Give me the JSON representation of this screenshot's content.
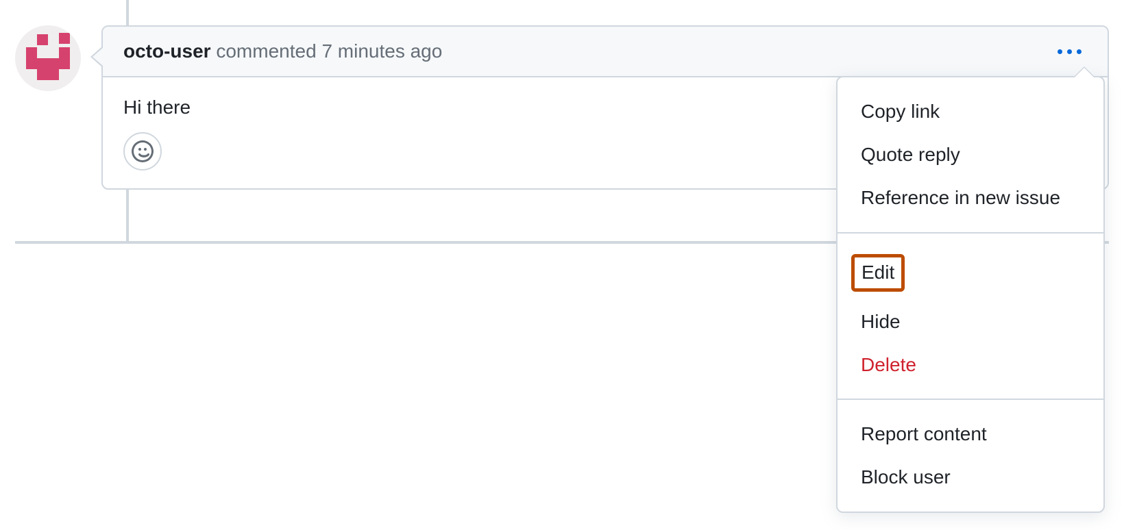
{
  "comment": {
    "author": "octo-user",
    "action": "commented",
    "timestamp": "7 minutes ago",
    "body": "Hi there"
  },
  "menu": {
    "section1": [
      {
        "label": "Copy link"
      },
      {
        "label": "Quote reply"
      },
      {
        "label": "Reference in new issue"
      }
    ],
    "section2": [
      {
        "label": "Edit",
        "highlighted": true
      },
      {
        "label": "Hide"
      },
      {
        "label": "Delete",
        "danger": true
      }
    ],
    "section3": [
      {
        "label": "Report content"
      },
      {
        "label": "Block user"
      }
    ]
  }
}
